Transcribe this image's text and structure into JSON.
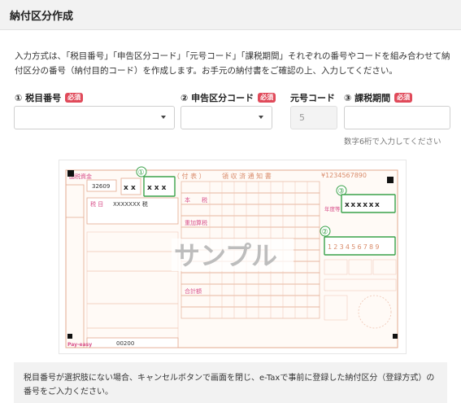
{
  "header": {
    "title": "納付区分作成"
  },
  "intro": "入力方式は、「税目番号」「申告区分コード」「元号コード」「課税期間」それぞれの番号やコードを組み合わせて納付区分の番号（納付目的コード）を作成します。お手元の納付書をご確認の上、入力してください。",
  "fields": {
    "tax_item": {
      "label": "① 税目番号",
      "required": "必須"
    },
    "filing_code": {
      "label": "② 申告区分コード",
      "required": "必須"
    },
    "era_code": {
      "label": "元号コード",
      "value": "5"
    },
    "tax_period": {
      "label": "③ 課税期間",
      "required": "必須",
      "hint": "数字6桁で入力してください"
    }
  },
  "sample": {
    "watermark": "サンプル",
    "marker_1": "①",
    "marker_2": "②",
    "marker_3": "③",
    "header_left": "国税資金",
    "form_title_a": "（ 付 表 ）",
    "form_title_b": "領 収 済 通 知 書",
    "amount_digits": "¥1234567890",
    "office_no": "32609",
    "tax_item_xs": "xxx",
    "tax_name_label": "税 目",
    "tax_name_value": "XXXXXXX 税",
    "tax_label": "本　　税",
    "surcharge_label": "重加算税",
    "total_label": "合計額",
    "period_label": "年度等",
    "period_xs": "xxxxxx",
    "code_digits": "123456789",
    "sample_label": "サンプル",
    "bottom_code": "00200",
    "brand": "Pay-easy"
  },
  "note": "税目番号が選択肢にない場合、キャンセルボタンで画面を閉じ、e-Taxで事前に登録した納付区分（登録方式）の番号をご入力ください。",
  "colors": {
    "accent_required": "#e04a5a",
    "form_orange": "#d98b6a",
    "form_pink": "#d8508a",
    "marker_green": "#3aa24a"
  }
}
